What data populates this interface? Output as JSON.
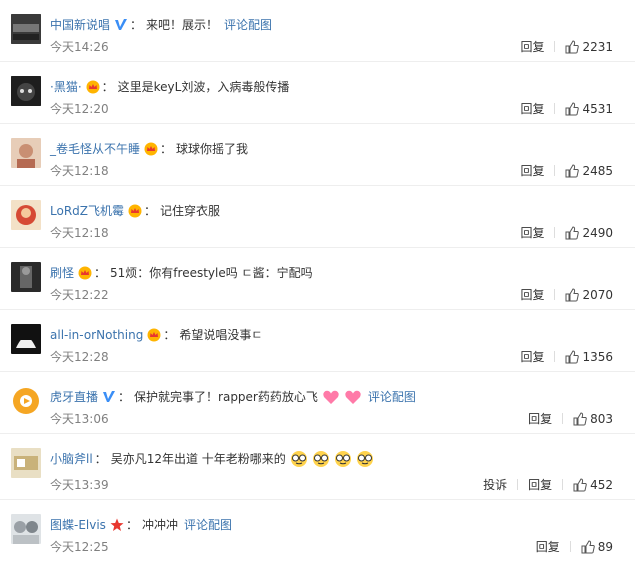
{
  "comments": [
    {
      "user": "中国新说唱",
      "badge": "verified-v",
      "blue_name": true,
      "text": "来吧！展示！",
      "link": "评论配图",
      "time": "今天14:26",
      "reply": "回复",
      "likes": "2231",
      "avatar_color": "#3a3a3a"
    },
    {
      "user": "·黑猫·",
      "badge": "crown",
      "text": "这里是keyL刘波，入病毒般传播",
      "time": "今天12:20",
      "reply": "回复",
      "likes": "4531",
      "avatar_color": "#222222"
    },
    {
      "user": "_卷毛怪从不午睡",
      "badge": "crown",
      "text": "球球你摇了我",
      "time": "今天12:18",
      "reply": "回复",
      "likes": "2485",
      "avatar_color": "#d4a58c"
    },
    {
      "user": "LoRdZ飞机霉",
      "badge": "crown",
      "text": "记住穿衣服",
      "time": "今天12:18",
      "reply": "回复",
      "likes": "2490",
      "avatar_color": "#c94a3a"
    },
    {
      "user": "刷怪",
      "badge": "crown",
      "text": "51烦：你有freestyle吗 ㄷ酱：宁配吗",
      "time": "今天12:22",
      "reply": "回复",
      "likes": "2070",
      "avatar_color": "#444444"
    },
    {
      "user": "all-in-orNothing",
      "badge": "crown",
      "text": "希望说唱没事ㄷ",
      "time": "今天12:28",
      "reply": "回复",
      "likes": "1356",
      "avatar_color": "#1a1a1a"
    },
    {
      "user": "虎牙直播",
      "badge": "verified-v",
      "blue_name": true,
      "text": "保护就完事了！rapper药药放心飞",
      "link": "评论配图",
      "emojis": [
        "heart-emoji",
        "heart-emoji"
      ],
      "time": "今天13:06",
      "reply": "回复",
      "likes": "803",
      "avatar_color": "#f5a623"
    },
    {
      "user": "小脑斧ll",
      "badge": "none",
      "text": "吴亦凡12年出道 十年老粉哪来的",
      "emojis": [
        "glasses-face-emoji",
        "glasses-face-emoji",
        "glasses-face-emoji",
        "glasses-face-emoji"
      ],
      "time": "今天13:39",
      "report": "投诉",
      "reply": "回复",
      "likes": "452",
      "avatar_color": "#c9b27a"
    },
    {
      "user": "图蝶-Elvis",
      "badge": "star",
      "text": "冲冲冲",
      "link": "评论配图",
      "time": "今天12:25",
      "reply": "回复",
      "likes": "89",
      "avatar_color": "#9aa0a6"
    }
  ]
}
